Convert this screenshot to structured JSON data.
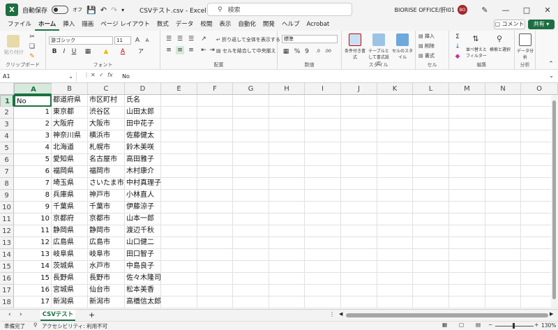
{
  "titlebar": {
    "autosave_label": "自動保存",
    "autosave_state": "オフ",
    "file_title": "CSVテスト.csv  -  Excel",
    "search_placeholder": "検索",
    "user_name": "BIORISE OFFICE/肝I01",
    "user_initials": "BO"
  },
  "ribbon_tabs": [
    "ファイル",
    "ホーム",
    "挿入",
    "描画",
    "ページ レイアウト",
    "数式",
    "データ",
    "校閲",
    "表示",
    "自動化",
    "開発",
    "ヘルプ",
    "Acrobat"
  ],
  "ribbon_tab_active": "ホーム",
  "comment_label": "コメント",
  "share_label": "共有",
  "ribbon": {
    "clipboard": {
      "label": "クリップボード",
      "paste": "貼り付け"
    },
    "font": {
      "label": "フォント",
      "family": "游ゴシック",
      "size": "11"
    },
    "alignment": {
      "label": "配置",
      "wrap": "折り返して全体を表示する",
      "merge": "セルを結合して中央揃え"
    },
    "number": {
      "label": "数値",
      "format": "標準"
    },
    "styles": {
      "label": "スタイル",
      "cond": "条件付き書式",
      "table": "テーブルとして書式設定",
      "cell": "セルのスタイル"
    },
    "cells": {
      "label": "セル",
      "insert": "挿入",
      "delete": "削除",
      "format": "書式"
    },
    "editing": {
      "label": "編集",
      "sort": "並べ替えとフィルター",
      "find": "検索と選択"
    },
    "analysis": {
      "label": "分析",
      "data_analysis": "データ分析"
    }
  },
  "formula_bar": {
    "name_box": "A1",
    "fx": "fx",
    "content": "No"
  },
  "columns": [
    "A",
    "B",
    "C",
    "D",
    "E",
    "F",
    "G",
    "H",
    "I",
    "J",
    "K",
    "L",
    "M",
    "N",
    "O"
  ],
  "rows": [
    {
      "n": "1",
      "a": "No",
      "b": "都道府県",
      "c": "市区町村",
      "d": "氏名"
    },
    {
      "n": "2",
      "a": "1",
      "b": "東京都",
      "c": "渋谷区",
      "d": "山田太郎"
    },
    {
      "n": "3",
      "a": "2",
      "b": "大阪府",
      "c": "大阪市",
      "d": "田中花子"
    },
    {
      "n": "4",
      "a": "3",
      "b": "神奈川県",
      "c": "横浜市",
      "d": "佐藤健太"
    },
    {
      "n": "5",
      "a": "4",
      "b": "北海道",
      "c": "札幌市",
      "d": "鈴木美咲"
    },
    {
      "n": "6",
      "a": "5",
      "b": "愛知県",
      "c": "名古屋市",
      "d": "高田雅子"
    },
    {
      "n": "7",
      "a": "6",
      "b": "福岡県",
      "c": "福岡市",
      "d": "木村康介"
    },
    {
      "n": "8",
      "a": "7",
      "b": "埼玉県",
      "c": "さいたま市",
      "d": "中村真理子"
    },
    {
      "n": "9",
      "a": "8",
      "b": "兵庫県",
      "c": "神戸市",
      "d": "小林直人"
    },
    {
      "n": "10",
      "a": "9",
      "b": "千葉県",
      "c": "千葉市",
      "d": "伊藤涼子"
    },
    {
      "n": "11",
      "a": "10",
      "b": "京都府",
      "c": "京都市",
      "d": "山本一郎"
    },
    {
      "n": "12",
      "a": "11",
      "b": "静岡県",
      "c": "静岡市",
      "d": "渡辺千秋"
    },
    {
      "n": "13",
      "a": "12",
      "b": "広島県",
      "c": "広島市",
      "d": "山口健二"
    },
    {
      "n": "14",
      "a": "13",
      "b": "岐阜県",
      "c": "岐阜市",
      "d": "田口智子"
    },
    {
      "n": "15",
      "a": "14",
      "b": "茨城県",
      "c": "水戸市",
      "d": "中島良子"
    },
    {
      "n": "16",
      "a": "15",
      "b": "長野県",
      "c": "長野市",
      "d": "佐々木隆司"
    },
    {
      "n": "17",
      "a": "16",
      "b": "宮城県",
      "c": "仙台市",
      "d": "松本美香"
    },
    {
      "n": "18",
      "a": "17",
      "b": "新潟県",
      "c": "新潟市",
      "d": "高橋信太郎"
    }
  ],
  "sheet_tab": "CSVテスト",
  "add_sheet": "+",
  "status": {
    "ready": "準備完了",
    "accessibility": "アクセシビリティ: 利用不可",
    "zoom": "130%"
  },
  "accent_color": "#1d6f42"
}
